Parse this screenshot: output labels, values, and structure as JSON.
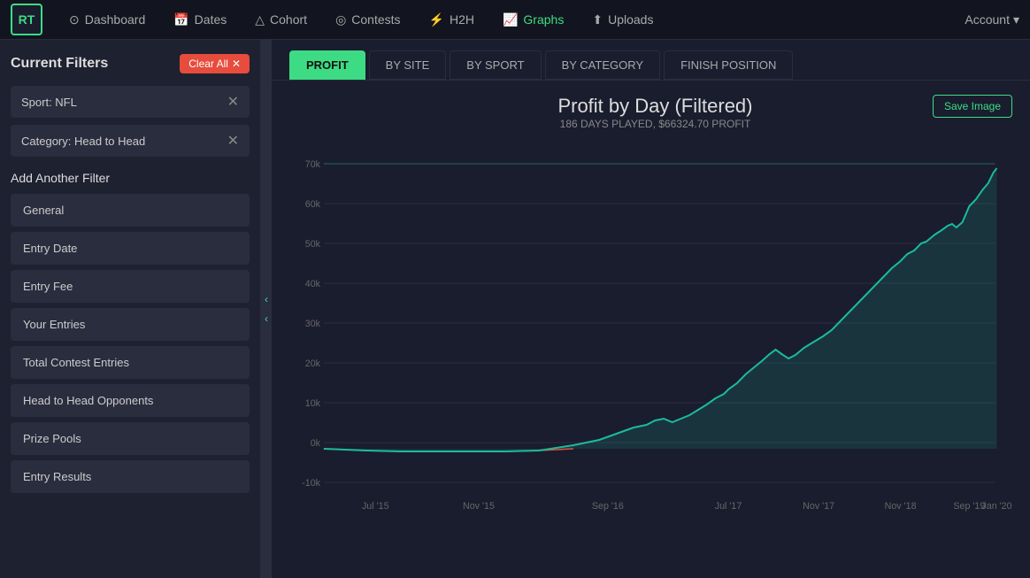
{
  "app": {
    "logo": "RT",
    "nav_items": [
      {
        "id": "dashboard",
        "label": "Dashboard",
        "icon": "⊙",
        "active": false
      },
      {
        "id": "dates",
        "label": "Dates",
        "icon": "📅",
        "active": false
      },
      {
        "id": "cohort",
        "label": "Cohort",
        "icon": "△",
        "active": false
      },
      {
        "id": "contests",
        "label": "Contests",
        "icon": "◎",
        "active": false
      },
      {
        "id": "h2h",
        "label": "H2H",
        "icon": "⚡",
        "active": false
      },
      {
        "id": "graphs",
        "label": "Graphs",
        "icon": "📈",
        "active": true
      },
      {
        "id": "uploads",
        "label": "Uploads",
        "icon": "⬆",
        "active": false
      }
    ],
    "account_label": "Account"
  },
  "sidebar": {
    "title": "Current Filters",
    "clear_all_label": "Clear All",
    "filters": [
      {
        "id": "sport-nfl",
        "label": "Sport: NFL"
      },
      {
        "id": "category-h2h",
        "label": "Category: Head to Head"
      }
    ],
    "add_filter_title": "Add Another Filter",
    "filter_buttons": [
      {
        "id": "general",
        "label": "General"
      },
      {
        "id": "entry-date",
        "label": "Entry Date"
      },
      {
        "id": "entry-fee",
        "label": "Entry Fee"
      },
      {
        "id": "your-entries",
        "label": "Your Entries"
      },
      {
        "id": "total-contest-entries",
        "label": "Total Contest Entries"
      },
      {
        "id": "head-to-head-opponents",
        "label": "Head to Head Opponents"
      },
      {
        "id": "prize-pools",
        "label": "Prize Pools"
      },
      {
        "id": "entry-results",
        "label": "Entry Results"
      }
    ]
  },
  "chart": {
    "tabs": [
      {
        "id": "profit",
        "label": "PROFIT",
        "active": true
      },
      {
        "id": "by-site",
        "label": "BY SITE",
        "active": false
      },
      {
        "id": "by-sport",
        "label": "BY SPORT",
        "active": false
      },
      {
        "id": "by-category",
        "label": "BY CATEGORY",
        "active": false
      },
      {
        "id": "finish-position",
        "label": "FINISH POSITION",
        "active": false
      }
    ],
    "title": "Profit by Day (Filtered)",
    "subtitle": "186 DAYS PLAYED, $66324.70 PROFIT",
    "save_image_label": "Save Image",
    "y_axis_labels": [
      "70k",
      "60k",
      "50k",
      "40k",
      "30k",
      "20k",
      "10k",
      "0k",
      "-10k"
    ],
    "x_axis_labels": [
      "Jul '15",
      "Nov '15",
      "Sep '16",
      "Jul '17",
      "Nov '17",
      "Nov '18",
      "Sep '19",
      "Jan '20"
    ]
  }
}
